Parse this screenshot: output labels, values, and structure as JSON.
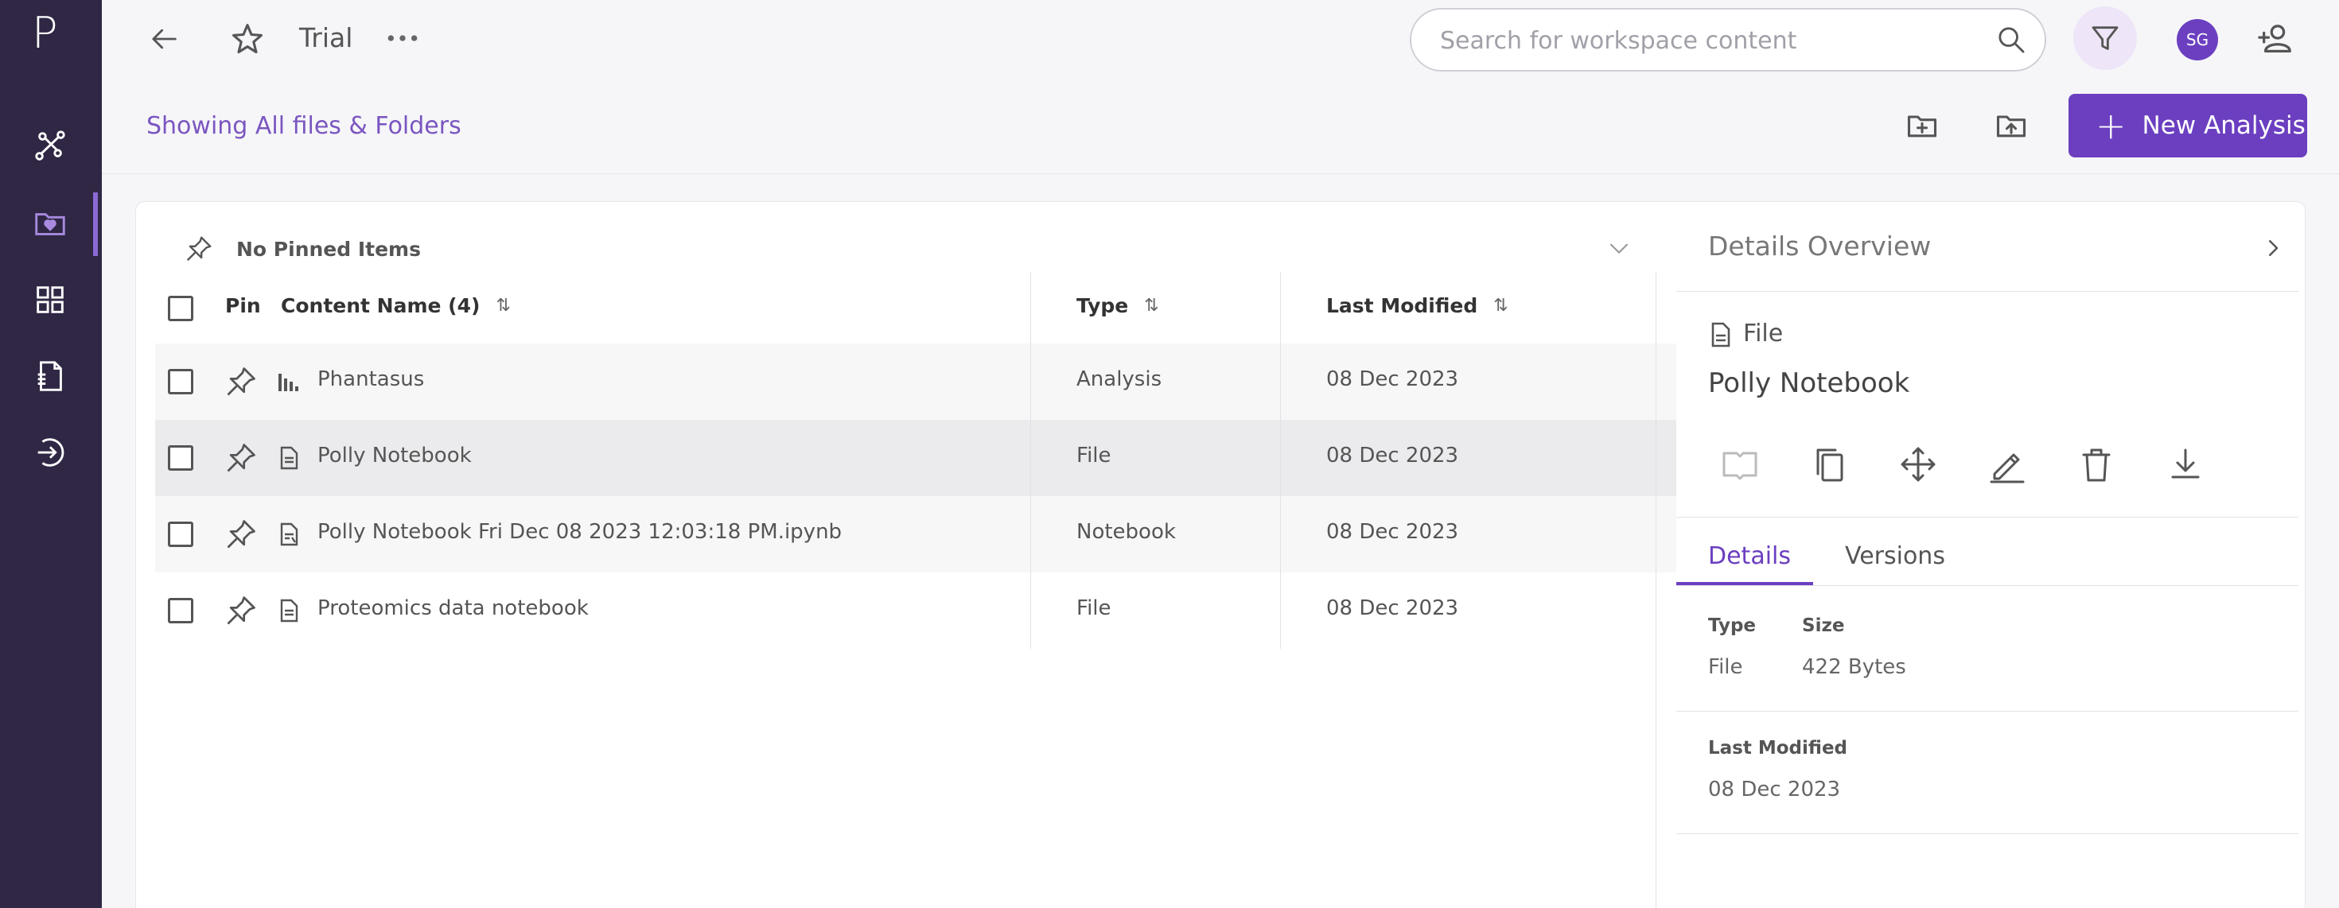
{
  "app": {
    "logo": "P",
    "accent": "#6b3fc0",
    "sidebar_bg": "#2f2744"
  },
  "sidebar": {
    "items": [
      {
        "icon": "pipeline-icon"
      },
      {
        "icon": "folder-heart-icon",
        "active": true
      },
      {
        "icon": "grid-icon"
      },
      {
        "icon": "document-data-icon"
      },
      {
        "icon": "exit-arrow-icon"
      }
    ]
  },
  "topbar": {
    "title": "Trial",
    "search_placeholder": "Search for workspace content",
    "avatar_initials": "SG"
  },
  "toolbar": {
    "showing_label": "Showing All files & Folders",
    "new_analysis_label": "New Analysis"
  },
  "pinned": {
    "label": "No Pinned Items"
  },
  "table": {
    "headers": {
      "pin": "Pin",
      "name": "Content Name (4)",
      "type": "Type",
      "modified": "Last Modified"
    },
    "rows": [
      {
        "name": "Phantasus",
        "type": "Analysis",
        "modified": "08 Dec 2023",
        "icon": "bar-chart-icon"
      },
      {
        "name": "Polly Notebook",
        "type": "File",
        "modified": "08 Dec 2023",
        "icon": "file-icon",
        "selected": true
      },
      {
        "name": "Polly Notebook Fri Dec 08 2023 12:03:18 PM.ipynb",
        "type": "Notebook",
        "modified": "08 Dec 2023",
        "icon": "notebook-file-icon"
      },
      {
        "name": "Proteomics data notebook",
        "type": "File",
        "modified": "08 Dec 2023",
        "icon": "file-icon"
      }
    ]
  },
  "details": {
    "title": "Details Overview",
    "kind": "File",
    "name": "Polly Notebook",
    "tabs": {
      "details": "Details",
      "versions": "Versions"
    },
    "type_label": "Type",
    "type_value": "File",
    "size_label": "Size",
    "size_value": "422 Bytes",
    "modified_label": "Last Modified",
    "modified_value": "08 Dec 2023"
  }
}
